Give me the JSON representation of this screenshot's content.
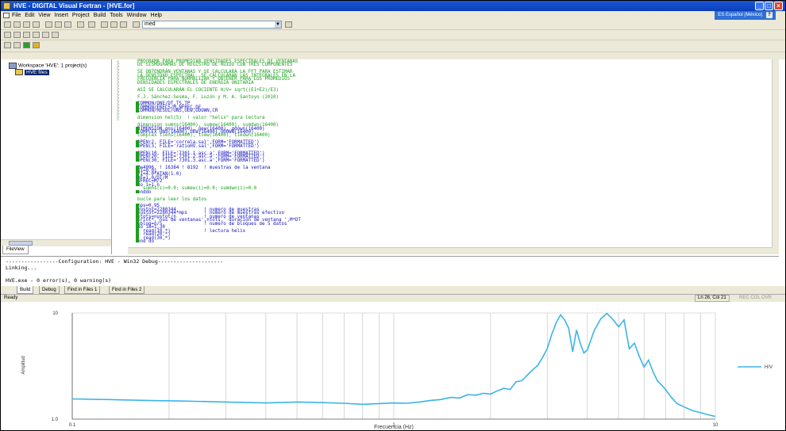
{
  "window": {
    "title": "HVE - DIGITAL Visual Fortran - [HVE.for]",
    "language_indicator": "ES Español (México)",
    "help_label": "?"
  },
  "menu": [
    "File",
    "Edit",
    "View",
    "Insert",
    "Project",
    "Build",
    "Tools",
    "Window",
    "Help"
  ],
  "toolbar": {
    "find_combo_value": "med"
  },
  "workspace": {
    "root": "Workspace 'HVE': 1 project(s)",
    "project": "HVE files",
    "tab": "FileView"
  },
  "code_lines": [
    {
      "t": "PROGRAMA PARA PROMEDIAR DENSIDADES ESPECTRALES DE VENTANAS",
      "c": "cm"
    },
    {
      "t": "DE SISMOGRAMAS DE REGISTRO DE RUIDO CON TRES COMPONENTES",
      "c": "cm"
    },
    {
      "t": "",
      "c": "cm"
    },
    {
      "t": "SE OBTENDRÁN VENTANAS Y SE CALCULARÁ LA FFT PARA ESTIMAR",
      "c": "cm"
    },
    {
      "t": "LA DENSIDAD ESPECTRAL. SE CALCULARÁN LAS INTEGRALES EN LA",
      "c": "cm"
    },
    {
      "t": "FRECUENCIA PARA NORMALIZAR Y OBTENER PARA LOS PROMEDIOS",
      "c": "cm"
    },
    {
      "t": "DENSIDADES ESPECTRALES DE ENERGÍA UNITARIA",
      "c": "cm"
    },
    {
      "t": "",
      "c": "cm"
    },
    {
      "t": "ASÍ SE CALCULARÁN EL COCIENTE H/V= sqrt((E1+E2)/E3)",
      "c": "cm"
    },
    {
      "t": "",
      "c": "cm"
    },
    {
      "t": "F.J. Sánchez-Sesma, F. Luzón y M. A. Santoyo (2010)",
      "c": "cm"
    },
    {
      "t": "",
      "c": "cm"
    },
    {
      "t": "COMMON/ONE/DT,TS,TP",
      "c": "kw"
    },
    {
      "t": "COMMON/FRECS/M,NFREC,DF",
      "c": "kw"
    },
    {
      "t": "COMMON/RESUL/UNS,UEW,UDOWN,CR",
      "c": "kw"
    },
    {
      "t": "",
      "c": "cm"
    },
    {
      "t": "dimension hel(5)  ! valor \"helix\" para lectura",
      "c": "cm"
    },
    {
      "t": "",
      "c": "cm"
    },
    {
      "t": "dimension sumns(16400), sumew(16400), sumdwn(16400)",
      "c": "cm"
    },
    {
      "t": "DIMENSION qns(16400), qew(16400), qdown(16400)",
      "c": "kw"
    },
    {
      "t": "COMPLEX UNS(16400),UEW(16400),UDOWN(16400)",
      "c": "kw"
    },
    {
      "t": "complex tiens(16400), tiew(16400), tiedwn(16400)",
      "c": "cm"
    },
    {
      "t": "",
      "c": "cm"
    },
    {
      "t": "OPEN(2, FILE='correla.sal',FORM='FORMATTED')",
      "c": "kw"
    },
    {
      "t": "OPEN(3, FILE='ratioHV.sal',FORM='FORMATTED')",
      "c": "kw"
    },
    {
      "t": "",
      "c": "cm"
    },
    {
      "t": "OPEN(10, FILE='7301.1.asc.a',FORM='FORMATTED')",
      "c": "kw"
    },
    {
      "t": "OPEN(20, FILE='7301.2.asc.a',FORM='FORMATTED')",
      "c": "kw"
    },
    {
      "t": "OPEN(30, FILE='7301.3.asc.a',FORM='FORMATTED')",
      "c": "kw"
    },
    {
      "t": "",
      "c": "cm"
    },
    {
      "t": "M=4096  ! 16384 ! 8192  ! muestras de la ventana",
      "c": "kw"
    },
    {
      "t": "DT=0.01",
      "c": "kw"
    },
    {
      "t": "PI=4.0*ATAN(1.0)",
      "c": "kw"
    },
    {
      "t": "DF=1.0/DT/M",
      "c": "kw"
    },
    {
      "t": "NFREC=M/2",
      "c": "kw"
    },
    {
      "t": "do i=1,n",
      "c": "kw"
    },
    {
      "t": "  sumns(i)=0.0; sumew(i)=0.0; sumdwn(i)=0.0",
      "c": "cm"
    },
    {
      "t": "enddo",
      "c": "kw"
    },
    {
      "t": "",
      "c": "cm"
    },
    {
      "t": "bucle para leer los datos",
      "c": "cm"
    },
    {
      "t": "",
      "c": "cm"
    },
    {
      "t": "mps=0.95",
      "c": "kw"
    },
    {
      "t": "nustot=2280344          ! numero de muestras",
      "c": "kw"
    },
    {
      "t": "nustot=2280344*mps      ! numero de muestras efectivo",
      "c": "kw"
    },
    {
      "t": "ntots=nustot/n          ! numero de ventanas",
      "c": "kw"
    },
    {
      "t": "print*,'nus de ventanas',ntots,' duracion de ventana ',M*DT",
      "c": "kw"
    },
    {
      "t": "nblog=n/5               ! numero de bloques de 5 datos",
      "c": "kw"
    },
    {
      "t": "do ib=1,30",
      "c": "kw"
    },
    {
      "t": "  read(10,*)            ! lectura helix",
      "c": "kw"
    },
    {
      "t": "  read(20,*)",
      "c": "kw"
    },
    {
      "t": "  read(30,*)",
      "c": "kw"
    },
    {
      "t": "end do",
      "c": "kw"
    }
  ],
  "output": {
    "lines": [
      "-----------------Configuration: HVE - Win32 Debug---------------------",
      "Linking...",
      "",
      "HVE.exe - 0 error(s), 0 warning(s)"
    ],
    "tabs": [
      "Build",
      "Debug",
      "Find in Files 1",
      "Find in Files 2"
    ]
  },
  "status": {
    "left": "Ready",
    "position": "Ln 26, Col 21",
    "indicators": "REC COL OVR READ"
  },
  "chart_data": {
    "type": "line",
    "xscale": "log",
    "yscale": "log",
    "xlim": [
      0.1,
      10
    ],
    "ylim": [
      1,
      10
    ],
    "xticks": [
      "0.1",
      "1",
      "10"
    ],
    "yticks": [
      "1.0",
      "10"
    ],
    "xlabel": "Frecuencia (Hz)",
    "ylabel": "Amplitud",
    "legend": "H/V",
    "color": "#3ab4e8",
    "x": [
      0.1,
      0.13,
      0.17,
      0.22,
      0.3,
      0.4,
      0.5,
      0.6,
      0.7,
      0.8,
      0.9,
      1.0,
      1.1,
      1.2,
      1.3,
      1.4,
      1.5,
      1.6,
      1.7,
      1.8,
      1.9,
      2.0,
      2.1,
      2.2,
      2.3,
      2.4,
      2.5,
      2.6,
      2.7,
      2.8,
      2.9,
      3.0,
      3.1,
      3.2,
      3.3,
      3.4,
      3.5,
      3.6,
      3.7,
      3.8,
      3.9,
      4.0,
      4.2,
      4.4,
      4.6,
      4.8,
      5.0,
      5.2,
      5.4,
      5.6,
      5.8,
      6.0,
      6.2,
      6.4,
      6.6,
      6.8,
      7.0,
      7.3,
      7.6,
      8.0,
      8.5,
      9.0,
      9.5,
      10.0
    ],
    "y": [
      1.55,
      1.53,
      1.5,
      1.48,
      1.45,
      1.42,
      1.45,
      1.43,
      1.41,
      1.38,
      1.4,
      1.42,
      1.41,
      1.45,
      1.5,
      1.53,
      1.6,
      1.58,
      1.7,
      1.68,
      1.75,
      1.72,
      1.85,
      1.95,
      1.9,
      2.25,
      2.3,
      2.6,
      2.9,
      3.2,
      3.8,
      4.6,
      6.3,
      8.1,
      9.6,
      8.6,
      7.2,
      4.3,
      6.9,
      5.2,
      4.2,
      4.5,
      6.8,
      8.8,
      9.9,
      8.7,
      7.4,
      8.6,
      4.6,
      5.2,
      3.9,
      3.1,
      3.6,
      2.8,
      2.3,
      2.1,
      1.9,
      1.6,
      1.4,
      1.3,
      1.2,
      1.15,
      1.1,
      1.06
    ]
  }
}
